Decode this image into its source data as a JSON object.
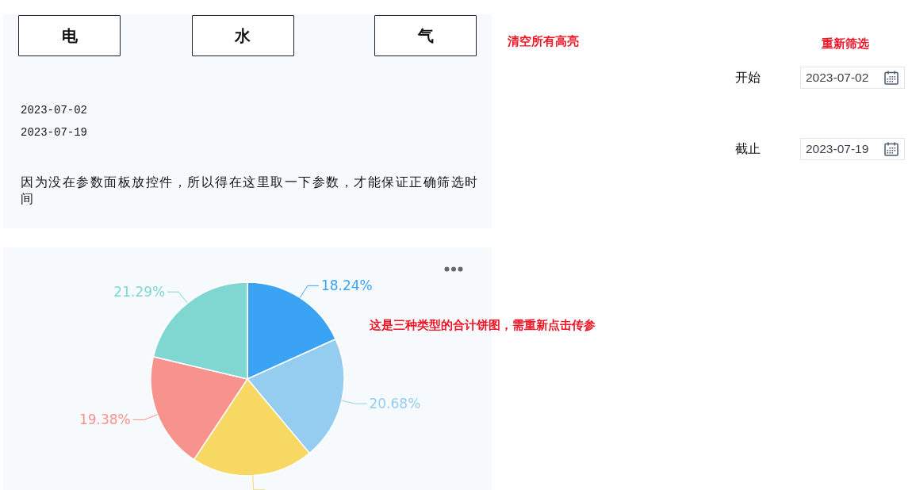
{
  "category_buttons": [
    "电",
    "水",
    "气"
  ],
  "parameter_dates": [
    "2023-07-02",
    "2023-07-19"
  ],
  "note": "因为没在参数面板放控件，所以得在这里取一下参数，才能保证正确筛选时间",
  "clear_highlights": "清空所有高亮",
  "reselect": "重新筛选",
  "date_filters": [
    {
      "label": "开始",
      "value": "2023-07-02"
    },
    {
      "label": "截止",
      "value": "2023-07-19"
    }
  ],
  "pie_panel": {
    "annotation": "这是三种类型的合计饼图，需重新点击传参",
    "chart_data": {
      "type": "pie",
      "values": [
        18.24,
        20.68,
        20.41,
        19.38,
        21.29
      ],
      "colors": [
        "#3aa3f4",
        "#94cdf0",
        "#f6d862",
        "#f7928c",
        "#80d6d0"
      ],
      "annotations": [
        {
          "text": "18.24%"
        },
        {
          "text": "20.68%"
        },
        {
          "text": "19.38%"
        },
        {
          "text": "21.29%"
        }
      ]
    }
  }
}
